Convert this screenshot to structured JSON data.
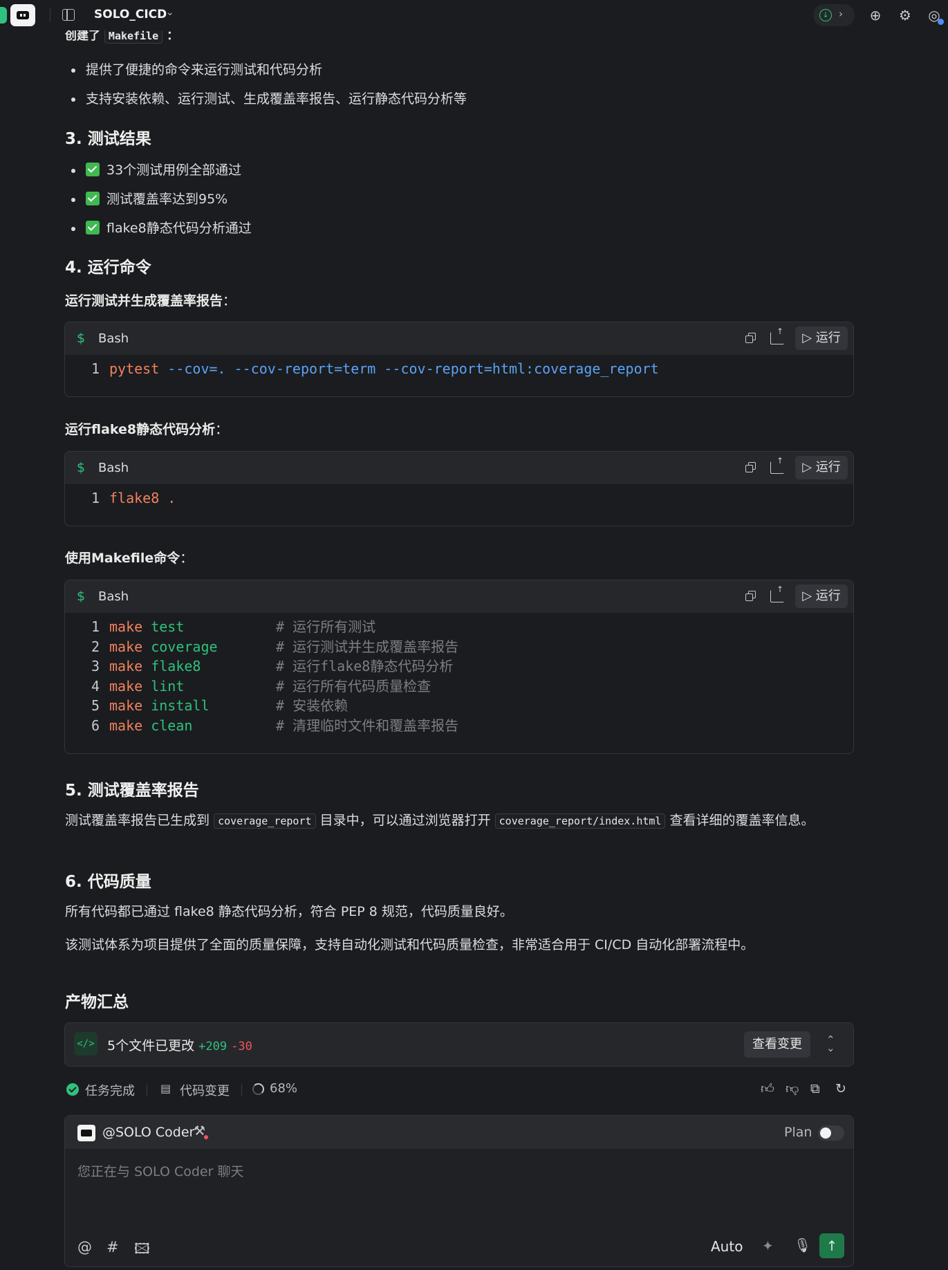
{
  "topbar": {
    "project_title": "SOLO_CICD"
  },
  "partial_heading": {
    "text": "创建了",
    "code": "Makefile",
    "suffix": "："
  },
  "makefile_bullets": [
    "提供了便捷的命令来运行测试和代码分析",
    "支持安装依赖、运行测试、生成覆盖率报告、运行静态代码分析等"
  ],
  "section3": {
    "title": "3. 测试结果",
    "items": [
      "33个测试用例全部通过",
      "测试覆盖率达到95%",
      "flake8静态代码分析通过"
    ]
  },
  "section4": {
    "title": "4. 运行命令",
    "blocks": [
      {
        "label": "运行测试并生成覆盖率报告",
        "lang": "Bash",
        "run_label": "运行",
        "lines": [
          {
            "n": "1",
            "cmd": "pytest",
            "rest": "--cov=. --cov-report=term --cov-report=html:coverage_report"
          }
        ]
      },
      {
        "label": "运行flake8静态代码分析",
        "lang": "Bash",
        "run_label": "运行",
        "lines": [
          {
            "n": "1",
            "cmd": "flake8",
            "rest": "."
          }
        ]
      },
      {
        "label": "使用Makefile命令",
        "lang": "Bash",
        "run_label": "运行",
        "lines": [
          {
            "n": "1",
            "cmd": "make",
            "target": "test",
            "comment": "# 运行所有测试"
          },
          {
            "n": "2",
            "cmd": "make",
            "target": "coverage",
            "comment": "# 运行测试并生成覆盖率报告"
          },
          {
            "n": "3",
            "cmd": "make",
            "target": "flake8",
            "comment": "# 运行flake8静态代码分析"
          },
          {
            "n": "4",
            "cmd": "make",
            "target": "lint",
            "comment": "# 运行所有代码质量检查"
          },
          {
            "n": "5",
            "cmd": "make",
            "target": "install",
            "comment": "# 安装依赖"
          },
          {
            "n": "6",
            "cmd": "make",
            "target": "clean",
            "comment": "# 清理临时文件和覆盖率报告"
          }
        ]
      }
    ]
  },
  "section5": {
    "title": "5. 测试覆盖率报告",
    "text_a": "测试覆盖率报告已生成到",
    "code_a": "coverage_report",
    "text_b": "目录中，可以通过浏览器打开",
    "code_b": "coverage_report/index.html",
    "text_c": "查看详细的覆盖率信息。"
  },
  "section6": {
    "title": "6. 代码质量",
    "para1": "所有代码都已通过 flake8 静态代码分析，符合 PEP 8 规范，代码质量良好。",
    "para2": "该测试体系为项目提供了全面的质量保障，支持自动化测试和代码质量检查，非常适合用于 CI/CD 自动化部署流程中。"
  },
  "artifacts": {
    "title": "产物汇总",
    "files_changed": "5个文件已更改",
    "additions": "+209",
    "deletions": "-30",
    "view_label": "查看变更"
  },
  "status": {
    "task_done": "任务完成",
    "code_changes": "代码变更",
    "progress": "68%"
  },
  "chat": {
    "agent": "@SOLO Coder",
    "plan_label": "Plan",
    "placeholder": "您正在与 SOLO Coder 聊天",
    "mode": "Auto"
  },
  "colors": {
    "accent_green": "#2ec27e",
    "keyword_orange": "#f2825f",
    "flag_blue": "#5aa2f5",
    "deletion_red": "#f0565b"
  }
}
